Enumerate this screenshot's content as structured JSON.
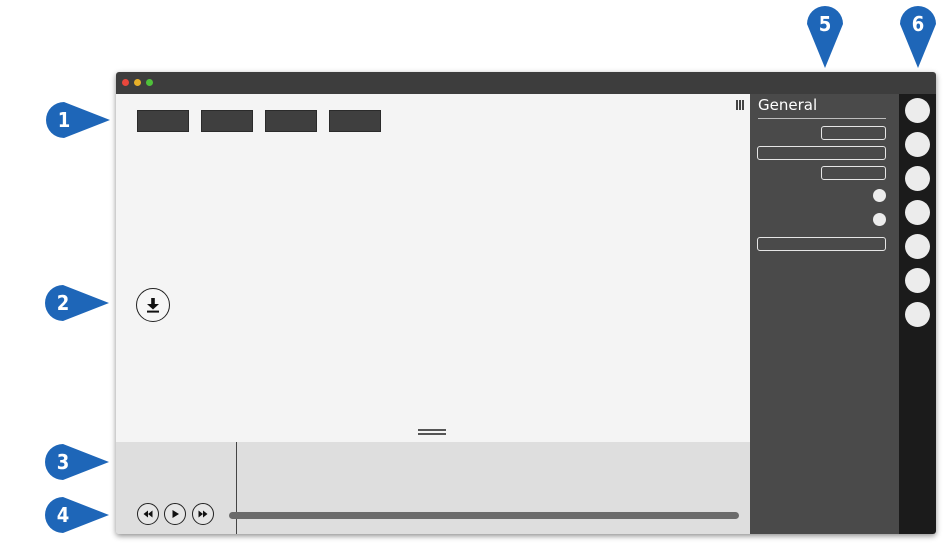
{
  "window": {
    "traffic_lights": {
      "close": "#e8473c",
      "minimize": "#e7b029",
      "maximize": "#4fc13a"
    }
  },
  "toolbar": {
    "button_count": 4
  },
  "settings_panel": {
    "title": "General",
    "fields": [
      "short-field",
      "wide-field",
      "short-field",
      "toggle",
      "toggle",
      "wide-field"
    ]
  },
  "icon_rail": {
    "button_count": 7
  },
  "transport": {
    "buttons": [
      "rewind-icon",
      "play-icon",
      "fast-forward-icon"
    ]
  },
  "callouts": [
    {
      "label": "1"
    },
    {
      "label": "2"
    },
    {
      "label": "3"
    },
    {
      "label": "4"
    },
    {
      "label": "5"
    },
    {
      "label": "6"
    }
  ],
  "colors": {
    "callout": "#1e66b8",
    "titlebar": "#3d3d3d",
    "settings_bg": "#4a4a4a",
    "rail_bg": "#1b1b1b",
    "canvas_bg": "#f4f4f4",
    "bottom_bg": "#dedede"
  }
}
